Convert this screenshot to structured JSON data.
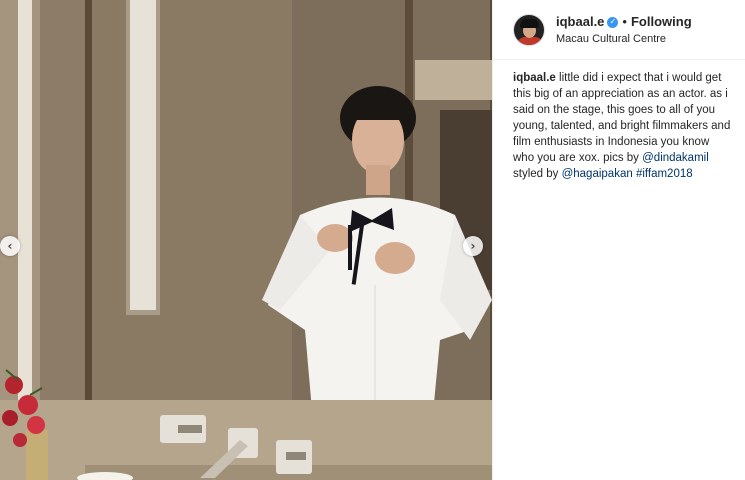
{
  "post": {
    "username": "iqbaal.e",
    "verified": true,
    "separator": "•",
    "follow_status": "Following",
    "location": "Macau Cultural Centre",
    "caption": {
      "username": "iqbaal.e",
      "text_before": "little did i expect that i would get this big of an appreciation as an actor. as i said on the stage, this goes to all of you young, talented, and bright filmmakers and film enthusiasts in Indonesia you know who you are xox. pics by",
      "mention1": "@dindakamil",
      "text_middle": "styled by",
      "mention2": "@hagaipakan",
      "hashtag": "#iffam2018"
    }
  },
  "carousel": {
    "prev_icon": "chevron-left-icon",
    "next_icon": "chevron-right-icon",
    "prev_glyph": "‹",
    "next_glyph": "›"
  },
  "icons": {
    "verified_glyph": "✓"
  },
  "colors": {
    "link": "#003569",
    "verified": "#3897f0",
    "text": "#262626"
  }
}
